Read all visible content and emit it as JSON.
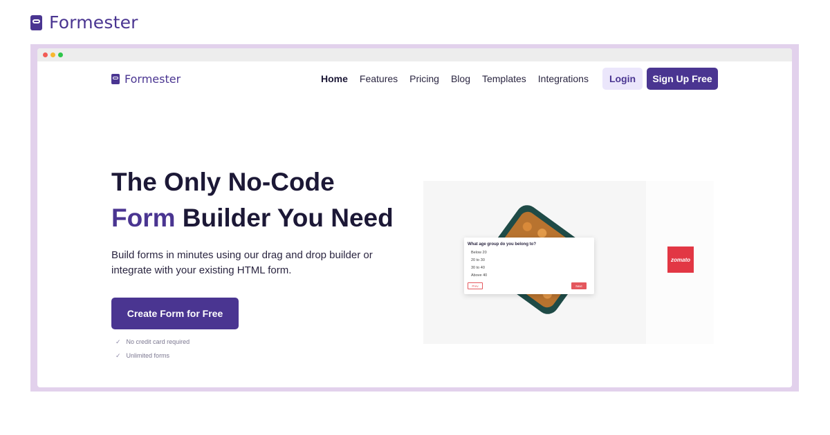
{
  "brand": {
    "name": "Formester",
    "icon": "formester-logo-icon"
  },
  "browser": {
    "controls": [
      "close-dot",
      "minimize-dot",
      "maximize-dot"
    ]
  },
  "site": {
    "brand_name": "Formester",
    "nav": [
      {
        "label": "Home",
        "active": true
      },
      {
        "label": "Features",
        "active": false
      },
      {
        "label": "Pricing",
        "active": false
      },
      {
        "label": "Blog",
        "active": false
      },
      {
        "label": "Templates",
        "active": false
      },
      {
        "label": "Integrations",
        "active": false
      }
    ],
    "login_label": "Login",
    "signup_label": "Sign Up Free"
  },
  "hero": {
    "title_line1": "The Only No-Code",
    "title_accent": "Form",
    "title_line2_rest": " Builder You Need",
    "subtitle": "Build forms in minutes using our drag and drop builder or integrate with your existing HTML form.",
    "cta_label": "Create Form for Free",
    "checks": [
      "No credit card required",
      "Unlimited forms"
    ]
  },
  "preview_form": {
    "question": "What age group do you belong to?",
    "options": [
      "Below 20",
      "20 to 30",
      "30 to 40",
      "Above 40"
    ],
    "prev_label": "Prev",
    "next_label": "Next"
  },
  "partner_logo": {
    "text": "zomato"
  },
  "colors": {
    "brand": "#4a3591",
    "frame": "#e2d1ec",
    "login_bg": "#ebe6fb",
    "zomato": "#e23744"
  }
}
